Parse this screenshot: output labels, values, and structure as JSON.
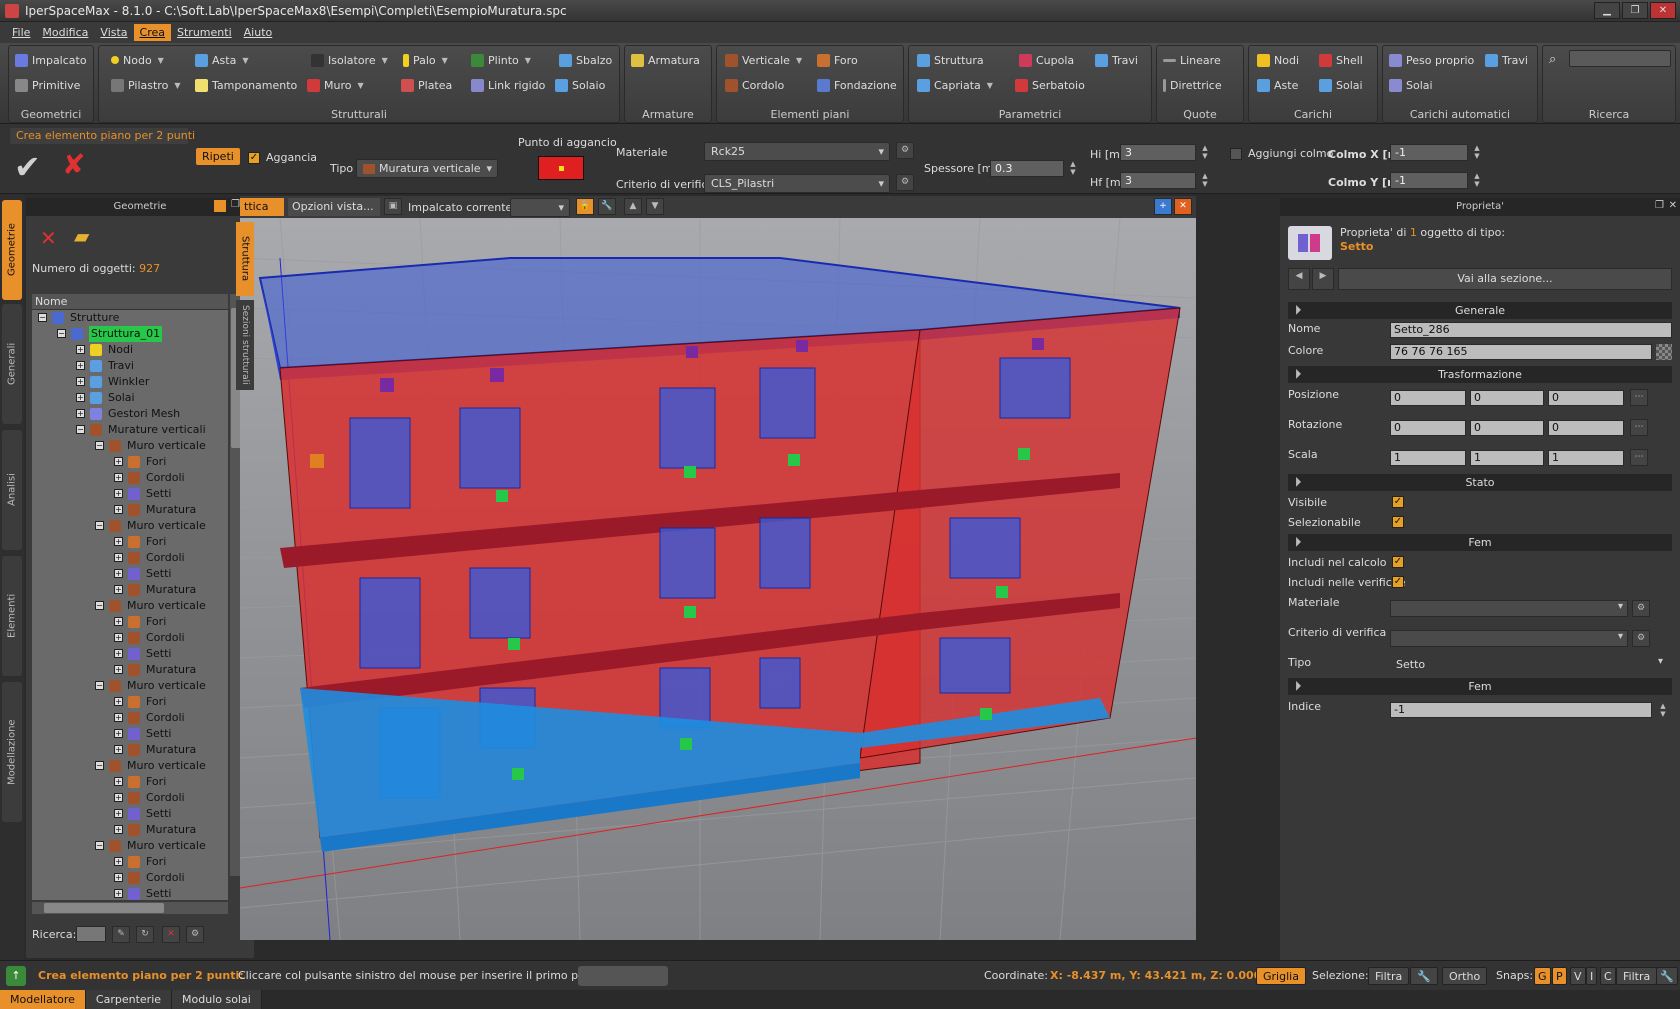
{
  "window": {
    "title": "IperSpaceMax - 8.1.0 - C:\\Soft.Lab\\IperSpaceMax8\\Esempi\\Completi\\EsempioMuratura.spc"
  },
  "menu": [
    "File",
    "Modifica",
    "Vista",
    "Crea",
    "Strumenti",
    "Aiuto"
  ],
  "menu_active": "Crea",
  "ribbon": {
    "geometrici": {
      "label": "Geometrici",
      "impalcato": "Impalcato",
      "primitive": "Primitive"
    },
    "strutturali": {
      "label": "Strutturali",
      "nodo": "Nodo",
      "asta": "Asta",
      "isolatore": "Isolatore",
      "palo": "Palo",
      "plinto": "Plinto",
      "sbalzo": "Sbalzo",
      "pilastro": "Pilastro",
      "tamponamento": "Tamponamento",
      "muro": "Muro",
      "platea": "Platea",
      "link_rigido": "Link rigido",
      "solaio": "Solaio"
    },
    "armature": {
      "label": "Armature",
      "armatura": "Armatura"
    },
    "elementi_piani": {
      "label": "Elementi piani",
      "verticale": "Verticale",
      "foro": "Foro",
      "cordolo": "Cordolo",
      "fondazione": "Fondazione"
    },
    "parametrici": {
      "label": "Parametrici",
      "struttura": "Struttura",
      "cupola": "Cupola",
      "travi": "Travi",
      "capriata": "Capriata",
      "serbatoio": "Serbatoio"
    },
    "quote": {
      "label": "Quote",
      "lineare": "Lineare",
      "direttrice": "Direttrice"
    },
    "carichi": {
      "label": "Carichi",
      "nodi": "Nodi",
      "shell": "Shell",
      "aste": "Aste",
      "solai": "Solai"
    },
    "carichi_automatici": {
      "label": "Carichi automatici",
      "peso_proprio": "Peso proprio",
      "travi": "Travi",
      "solai": "Solai"
    },
    "ricerca": {
      "label": "Ricerca"
    }
  },
  "options": {
    "command": "Crea elemento piano per 2 punti",
    "ripeti": "Ripeti",
    "aggancia": "Aggancia",
    "tipo_label": "Tipo",
    "tipo_value": "Muratura verticale",
    "punto_aggancio": "Punto di aggancio",
    "materiale_label": "Materiale",
    "materiale_value": "Rck25",
    "criterio_label": "Criterio di verifica",
    "criterio_value": "CLS_Pilastri",
    "spessore_label": "Spessore [m]",
    "spessore_value": "0.3",
    "hi_label": "Hi [m]",
    "hi_value": "3",
    "hf_label": "Hf [m]",
    "hf_value": "3",
    "colmo_label": "Aggiungi colmo",
    "colmo_x_label": "Colmo X [m]",
    "colmo_x_value": "-1",
    "colmo_y_label": "Colmo Y [m]",
    "colmo_y_value": "-1"
  },
  "left_tabs": [
    "Geometrie",
    "Generali",
    "Analisi",
    "Elementi",
    "Modellazione"
  ],
  "geometrie": {
    "title": "Geometrie",
    "count_label": "Numero di oggetti:",
    "count_value": "927",
    "col_header": "Nome",
    "search_label": "Ricerca:",
    "tree": [
      {
        "lvl": 0,
        "label": "Strutture",
        "exp": "−",
        "icon": "#4a6ad0"
      },
      {
        "lvl": 1,
        "label": "Struttura_01",
        "exp": "−",
        "icon": "#4a6ad0",
        "sel": true
      },
      {
        "lvl": 2,
        "label": "Nodi",
        "exp": "+",
        "icon": "#f0d020"
      },
      {
        "lvl": 2,
        "label": "Travi",
        "exp": "+",
        "icon": "#5aa0e0"
      },
      {
        "lvl": 2,
        "label": "Winkler",
        "exp": "+",
        "icon": "#5aa0e0"
      },
      {
        "lvl": 2,
        "label": "Solai",
        "exp": "+",
        "icon": "#5aa0e0"
      },
      {
        "lvl": 2,
        "label": "Gestori Mesh",
        "exp": "+",
        "icon": "#8080e0"
      },
      {
        "lvl": 2,
        "label": "Murature verticali",
        "exp": "−",
        "icon": "#a0522d"
      },
      {
        "lvl": 3,
        "label": "Muro verticale",
        "exp": "−",
        "icon": "#a0522d"
      },
      {
        "lvl": 4,
        "label": "Fori",
        "exp": "+",
        "icon": "#c87030"
      },
      {
        "lvl": 4,
        "label": "Cordoli",
        "exp": "+",
        "icon": "#a0522d"
      },
      {
        "lvl": 4,
        "label": "Setti",
        "exp": "+",
        "icon": "#7060d0"
      },
      {
        "lvl": 4,
        "label": "Muratura",
        "exp": "+",
        "icon": "#a0522d"
      },
      {
        "lvl": 3,
        "label": "Muro verticale",
        "exp": "−",
        "icon": "#a0522d"
      },
      {
        "lvl": 4,
        "label": "Fori",
        "exp": "+",
        "icon": "#c87030"
      },
      {
        "lvl": 4,
        "label": "Cordoli",
        "exp": "+",
        "icon": "#a0522d"
      },
      {
        "lvl": 4,
        "label": "Setti",
        "exp": "+",
        "icon": "#7060d0"
      },
      {
        "lvl": 4,
        "label": "Muratura",
        "exp": "+",
        "icon": "#a0522d"
      },
      {
        "lvl": 3,
        "label": "Muro verticale",
        "exp": "−",
        "icon": "#a0522d"
      },
      {
        "lvl": 4,
        "label": "Fori",
        "exp": "+",
        "icon": "#c87030"
      },
      {
        "lvl": 4,
        "label": "Cordoli",
        "exp": "+",
        "icon": "#a0522d"
      },
      {
        "lvl": 4,
        "label": "Setti",
        "exp": "+",
        "icon": "#7060d0"
      },
      {
        "lvl": 4,
        "label": "Muratura",
        "exp": "+",
        "icon": "#a0522d"
      },
      {
        "lvl": 3,
        "label": "Muro verticale",
        "exp": "−",
        "icon": "#a0522d"
      },
      {
        "lvl": 4,
        "label": "Fori",
        "exp": "+",
        "icon": "#c87030"
      },
      {
        "lvl": 4,
        "label": "Cordoli",
        "exp": "+",
        "icon": "#a0522d"
      },
      {
        "lvl": 4,
        "label": "Setti",
        "exp": "+",
        "icon": "#7060d0"
      },
      {
        "lvl": 4,
        "label": "Muratura",
        "exp": "+",
        "icon": "#a0522d"
      },
      {
        "lvl": 3,
        "label": "Muro verticale",
        "exp": "−",
        "icon": "#a0522d"
      },
      {
        "lvl": 4,
        "label": "Fori",
        "exp": "+",
        "icon": "#c87030"
      },
      {
        "lvl": 4,
        "label": "Cordoli",
        "exp": "+",
        "icon": "#a0522d"
      },
      {
        "lvl": 4,
        "label": "Setti",
        "exp": "+",
        "icon": "#7060d0"
      },
      {
        "lvl": 4,
        "label": "Muratura",
        "exp": "+",
        "icon": "#a0522d"
      },
      {
        "lvl": 3,
        "label": "Muro verticale",
        "exp": "−",
        "icon": "#a0522d"
      },
      {
        "lvl": 4,
        "label": "Fori",
        "exp": "+",
        "icon": "#c87030"
      },
      {
        "lvl": 4,
        "label": "Cordoli",
        "exp": "+",
        "icon": "#a0522d"
      },
      {
        "lvl": 4,
        "label": "Setti",
        "exp": "+",
        "icon": "#7060d0"
      }
    ]
  },
  "viewtabs": {
    "tab1": "ttica",
    "tab2": "Opzioni vista...",
    "impalcato_label": "Impalcato corrente:",
    "side_tab1": "Struttura",
    "side_tab2": "Sezioni strutturali"
  },
  "properties": {
    "title": "Proprieta'",
    "header_prefix": "Proprieta' di",
    "header_count": "1",
    "header_suffix": "oggetto di tipo:",
    "header_type": "Setto",
    "goto_section": "Vai alla sezione...",
    "sec_generale": "Generale",
    "nome_label": "Nome",
    "nome_value": "Setto_286",
    "colore_label": "Colore",
    "colore_value": "76 76 76 165",
    "sec_trasf": "Trasformazione",
    "posizione_label": "Posizione",
    "posizione": [
      "0",
      "0",
      "0"
    ],
    "rotazione_label": "Rotazione",
    "rotazione": [
      "0",
      "0",
      "0"
    ],
    "scala_label": "Scala",
    "scala": [
      "1",
      "1",
      "1"
    ],
    "sec_stato": "Stato",
    "visibile_label": "Visibile",
    "selezionabile_label": "Selezionabile",
    "sec_fem": "Fem",
    "includi_calcolo_label": "Includi nel calcolo",
    "includi_verifiche_label": "Includi nelle verifiche",
    "materiale_label": "Materiale",
    "criterio_label": "Criterio di verifica",
    "tipo_label": "Tipo",
    "tipo_value": "Setto",
    "sec_fem2": "Fem",
    "indice_label": "Indice",
    "indice_value": "-1"
  },
  "status": {
    "command": "Crea elemento piano per 2 punti:",
    "hint": "Cliccare col pulsante sinistro del mouse per inserire il primo punto",
    "coord_label": "Coordinate:",
    "coord_value": "X: -8.437 m, Y: 43.421 m, Z: 0.000 m",
    "griglia": "Griglia",
    "selezione_label": "Selezione:",
    "filtra": "Filtra",
    "ortho": "Ortho",
    "snaps_label": "Snaps:",
    "snaps": [
      "G",
      "P",
      "V",
      "I",
      "C"
    ],
    "filtra2": "Filtra"
  },
  "bottom_tabs": [
    "Modellatore",
    "Carpenterie",
    "Modulo solai"
  ],
  "colors": {
    "accent": "#e8902a",
    "wall": "#d83030",
    "slab": "#3a5ad8",
    "foundation": "#1e8ee0",
    "selection": "#27c74a"
  }
}
